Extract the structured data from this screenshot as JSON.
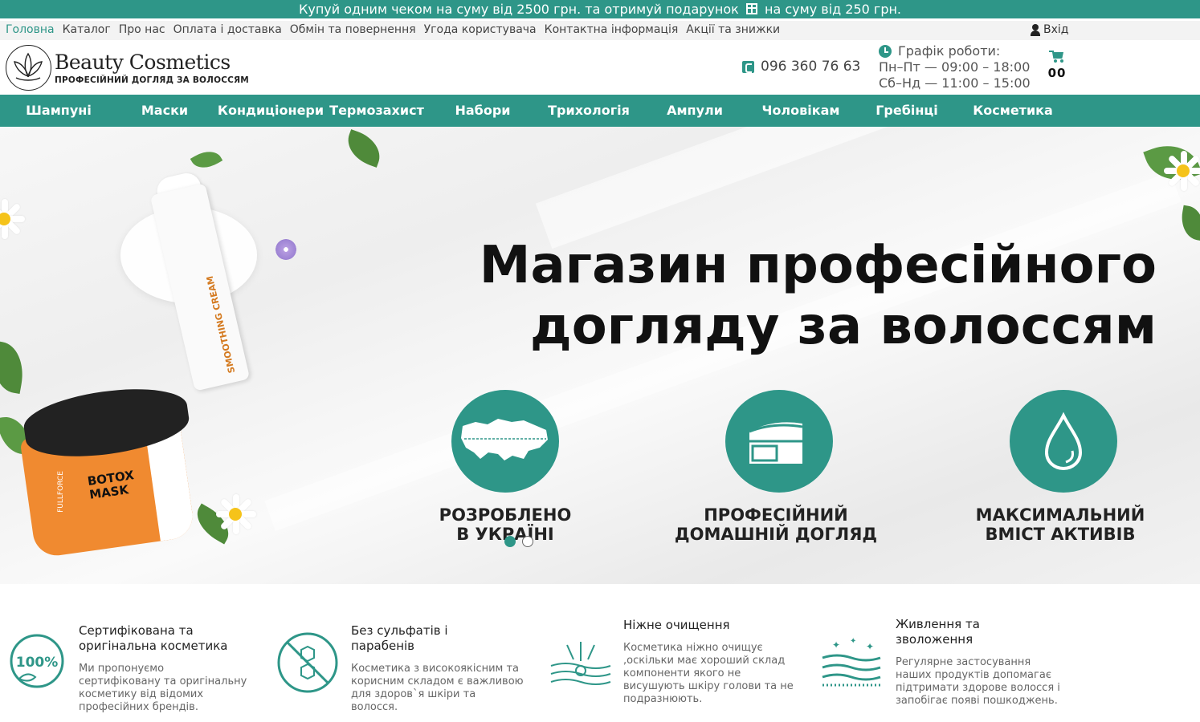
{
  "promo": {
    "before": "Купуй одним чеком на суму від 2500 грн. та отримуй подарунок",
    "after": "на суму від 250 грн.",
    "icon": "gift-icon"
  },
  "top_nav": {
    "items": [
      {
        "label": "Головна",
        "active": true
      },
      {
        "label": "Каталог"
      },
      {
        "label": "Про нас"
      },
      {
        "label": "Оплата і доставка"
      },
      {
        "label": "Обмін та повернення"
      },
      {
        "label": "Угода користувача"
      },
      {
        "label": "Контактна інформація"
      },
      {
        "label": "Акції та знижки"
      }
    ],
    "login_label": "Вхід"
  },
  "header": {
    "logo_title": "Beauty Cosmetics",
    "logo_subtitle": "ПРОФЕСІЙНИЙ ДОГЛЯД ЗА ВОЛОССЯМ",
    "phone": "096 360 76 63",
    "schedule_title": "Графік роботи:",
    "schedule_weekdays": "Пн–Пт — 09:00 – 18:00",
    "schedule_weekend": "Сб–Нд — 11:00 – 15:00",
    "cart_count": "00"
  },
  "main_menu": [
    "Шампуні",
    "Маски",
    "Кондиціонери",
    "Термозахист",
    "Набори",
    "Трихологія",
    "Ампули",
    "Чоловікам",
    "Гребінці",
    "Косметика"
  ],
  "hero": {
    "title_line1": "Магазин професійного",
    "title_line2": "догляду за волоссям",
    "features": [
      {
        "line1": "РОЗРОБЛЕНО",
        "line2": "В УКРАЇНІ",
        "icon": "ukraine-map-icon"
      },
      {
        "line1": "ПРОФЕСІЙНИЙ",
        "line2": "ДОМАШНІЙ ДОГЛЯД",
        "icon": "cream-jar-icon"
      },
      {
        "line1": "МАКСИМАЛЬНИЙ",
        "line2": "ВМІСТ АКТИВІВ",
        "icon": "drop-icon"
      }
    ],
    "jar_label_line1": "BOTOX",
    "jar_label_line2": "MASK",
    "jar_brand": "FULLFORCE",
    "bottle_label": "SMOOTHING CREAM",
    "slides_total": 2,
    "slide_active": 1
  },
  "benefits": [
    {
      "title": "Сертифікована та оригінальна косметика",
      "text": "Ми пропонуємо сертифіковану та оригінальну косметику від відомих професійних брендів.",
      "icon": "certified-100-icon",
      "badge": "100%"
    },
    {
      "title": "Без сульфатів і парабенів",
      "text": "Косметика з високоякісним та корисним складом є важливою для здоров`я шкіри та волосся.",
      "icon": "no-chemicals-icon"
    },
    {
      "title": "Ніжне очищення",
      "text": "Косметика ніжно очищує ,оскільки має хороший склад компоненти якого не висушують шкіру голови та не подразнюють.",
      "icon": "gentle-cleansing-icon"
    },
    {
      "title": "Живлення та зволоження",
      "text": "Регулярне застосування наших продуктів допомагає підтримати здорове волосся і запобігає появі пошкоджень.",
      "icon": "moisturizing-icon"
    }
  ],
  "colors": {
    "accent": "#2e9688",
    "text": "#222222"
  }
}
